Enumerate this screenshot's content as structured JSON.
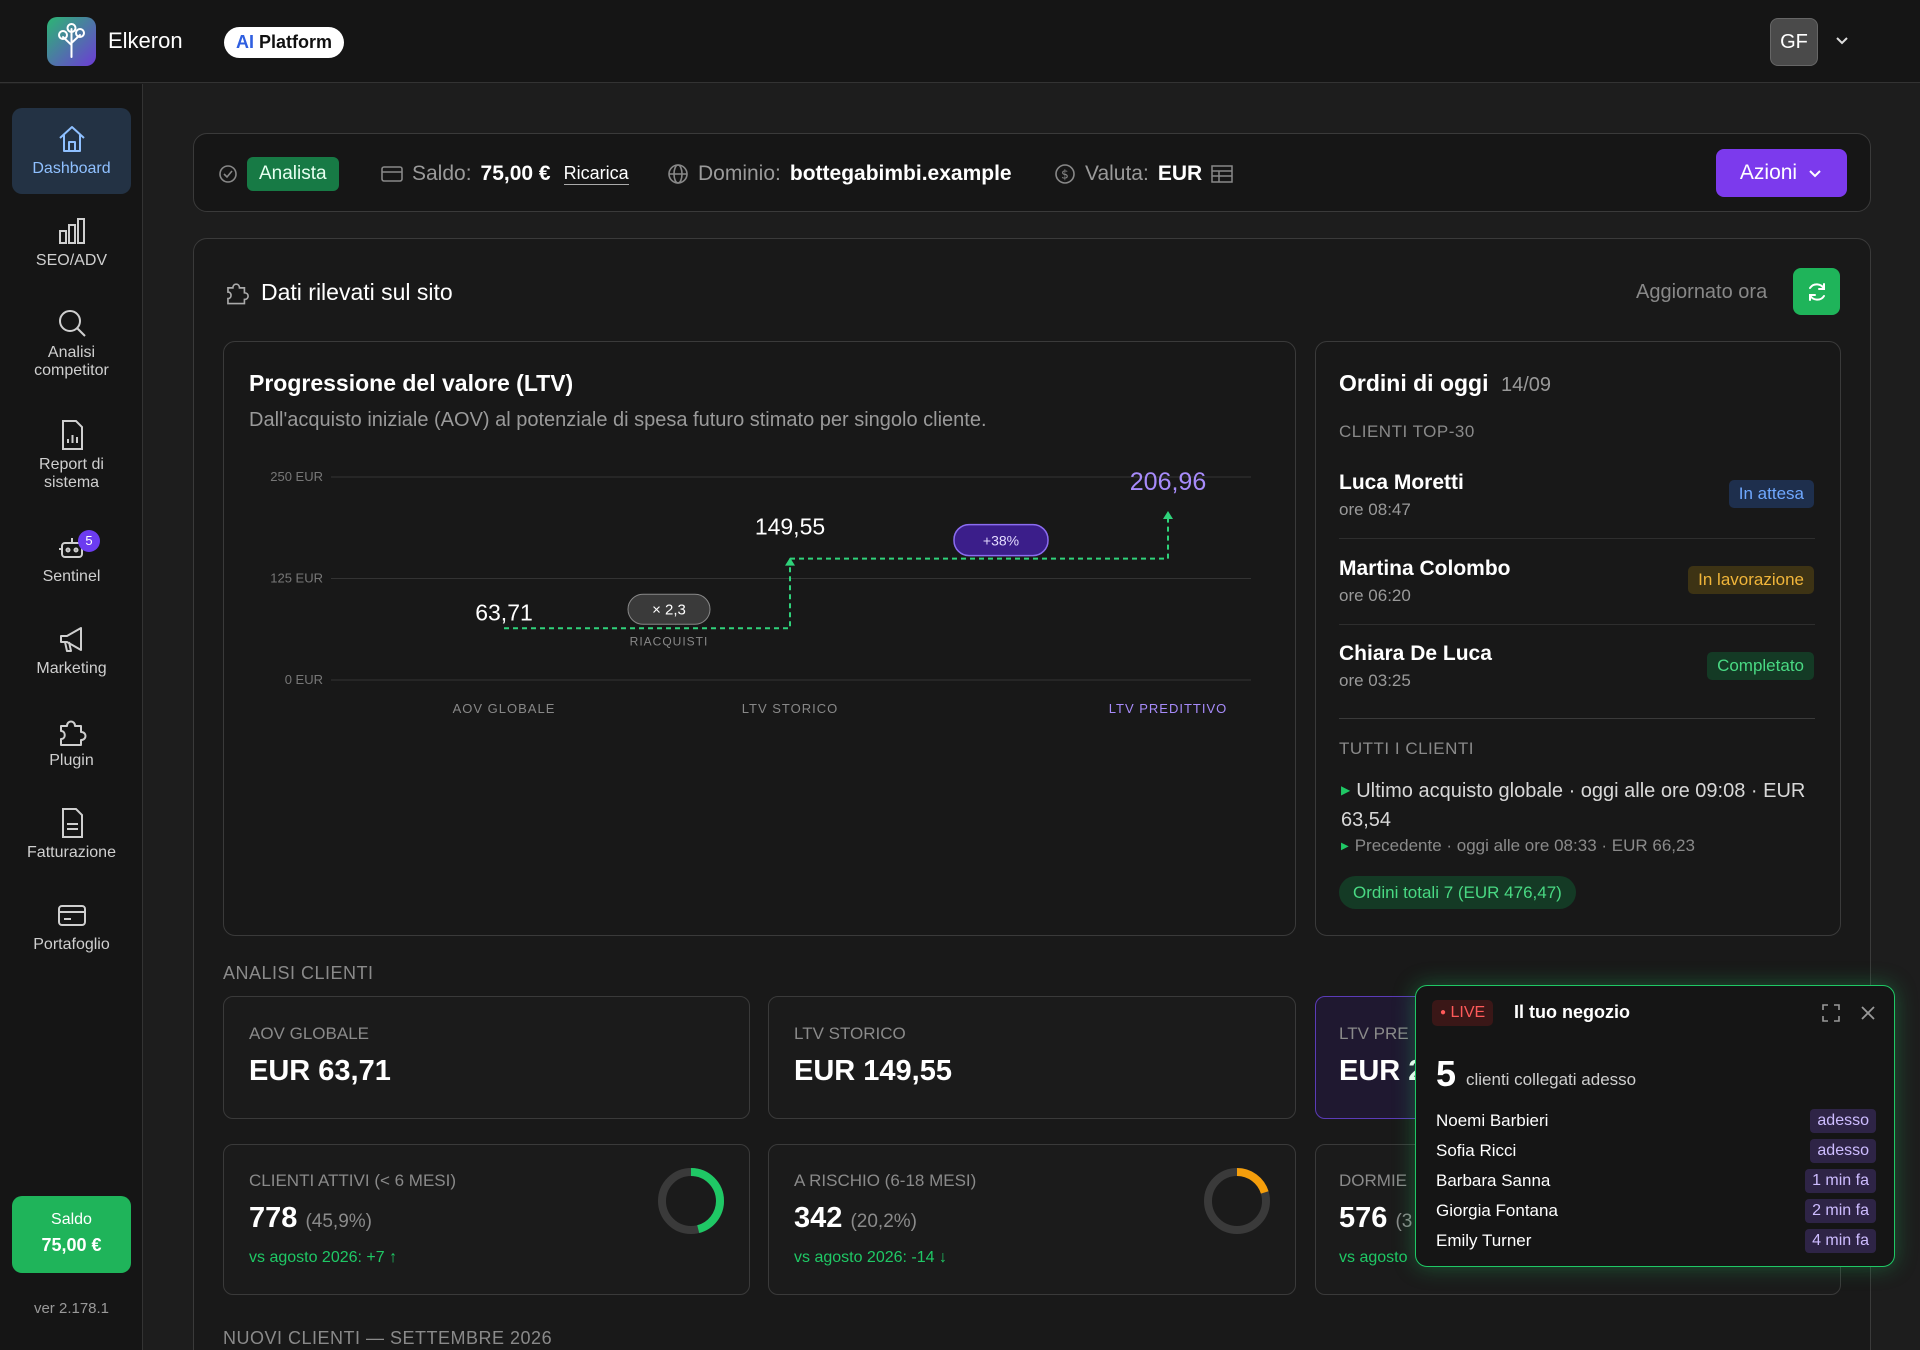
{
  "app": {
    "brand": "Elkeron",
    "platform_ai": "AI",
    "platform_label": "Platform",
    "user_initials": "GF"
  },
  "sidebar": {
    "items": [
      {
        "label": "Dashboard",
        "icon": "home-icon"
      },
      {
        "label": "SEO/ADV",
        "icon": "bar-chart-icon"
      },
      {
        "label": "Analisi competitor",
        "icon": "search-icon"
      },
      {
        "label": "Report di sistema",
        "icon": "report-icon"
      },
      {
        "label": "Sentinel",
        "icon": "robot-icon",
        "badge": "5"
      },
      {
        "label": "Marketing",
        "icon": "megaphone-icon"
      },
      {
        "label": "Plugin",
        "icon": "puzzle-icon"
      },
      {
        "label": "Fatturazione",
        "icon": "invoice-icon"
      },
      {
        "label": "Portafoglio",
        "icon": "wallet-icon"
      }
    ],
    "saldo_label": "Saldo",
    "saldo_value": "75,00 €",
    "version": "ver 2.178.1"
  },
  "header": {
    "role": "Analista",
    "saldo_label": "Saldo:",
    "saldo_value": "75,00 €",
    "ricarica": "Ricarica",
    "dominio_label": "Dominio:",
    "dominio_value": "bottegabimbi.example",
    "valuta_label": "Valuta:",
    "valuta_value": "EUR",
    "azioni": "Azioni"
  },
  "section": {
    "title": "Dati rilevati sul sito",
    "updated": "Aggiornato ora"
  },
  "ltv": {
    "title": "Progressione del valore (LTV)",
    "subtitle": "Dall'acquisto iniziale (AOV) al potenziale di spesa futuro stimato per singolo cliente."
  },
  "chart_data": {
    "type": "line",
    "categories": [
      "AOV GLOBALE",
      "LTV STORICO",
      "LTV PREDITTIVO"
    ],
    "values": [
      63.71,
      149.55,
      206.96
    ],
    "value_labels": [
      "63,71",
      "149,55",
      "206,96"
    ],
    "y_ticks": [
      "0 EUR",
      "125 EUR",
      "250 EUR"
    ],
    "ylim": [
      0,
      250
    ],
    "annotations": {
      "multiplier": "× 2,3",
      "multiplier_label": "RIACQUISTI",
      "growth": "+38%"
    },
    "colors": {
      "line": "#2fd27a",
      "highlight": "#a78bfa",
      "growth_pill": "#3b1e8a"
    }
  },
  "orders": {
    "title": "Ordini di oggi",
    "date": "14/09",
    "top_label": "CLIENTI TOP-30",
    "list": [
      {
        "name": "Luca Moretti",
        "time": "ore 08:47",
        "status": "In attesa",
        "bg": "#1e2f4d",
        "fg": "#6fa8ff"
      },
      {
        "name": "Martina Colombo",
        "time": "ore 06:20",
        "status": "In lavorazione",
        "bg": "#3d3314",
        "fg": "#f0b53a"
      },
      {
        "name": "Chiara De Luca",
        "time": "ore 03:25",
        "status": "Completato",
        "bg": "#143a25",
        "fg": "#49d983"
      }
    ],
    "all_label": "TUTTI I CLIENTI",
    "last_purchase": "Ultimo acquisto globale · oggi alle ore 09:08 · EUR 63,54",
    "previous": "Precedente · oggi alle ore 08:33 · EUR 66,23",
    "total": "Ordini totali 7 (EUR 476,47)"
  },
  "analysis": {
    "label": "ANALISI CLIENTI",
    "cards": [
      {
        "label": "AOV GLOBALE",
        "value": "EUR 63,71"
      },
      {
        "label": "LTV STORICO",
        "value": "EUR 149,55"
      },
      {
        "label": "LTV PRE",
        "value": "EUR 2"
      }
    ],
    "segments": [
      {
        "label": "CLIENTI ATTIVI (< 6 MESI)",
        "value": "778",
        "pct": "(45,9%)",
        "vs": "vs agosto 2026: +7 ↑",
        "ring_fraction": 0.459,
        "ring_color": "#1fc865"
      },
      {
        "label": "A RISCHIO (6-18 MESI)",
        "value": "342",
        "pct": "(20,2%)",
        "vs": "vs agosto 2026: -14 ↓",
        "ring_fraction": 0.202,
        "ring_color": "#f59e0b"
      },
      {
        "label": "DORMIE",
        "value": "576",
        "pct": "(3",
        "vs": "vs agosto"
      }
    ],
    "new_clients_label": "NUOVI CLIENTI — SETTEMBRE 2026"
  },
  "live": {
    "badge": "LIVE",
    "title": "Il tuo negozio",
    "count": "5",
    "count_label": "clienti collegati adesso",
    "visitors": [
      {
        "name": "Noemi Barbieri",
        "time": "adesso"
      },
      {
        "name": "Sofia Ricci",
        "time": "adesso"
      },
      {
        "name": "Barbara Sanna",
        "time": "1 min fa"
      },
      {
        "name": "Giorgia Fontana",
        "time": "2 min fa"
      },
      {
        "name": "Emily Turner",
        "time": "4 min fa"
      }
    ]
  }
}
